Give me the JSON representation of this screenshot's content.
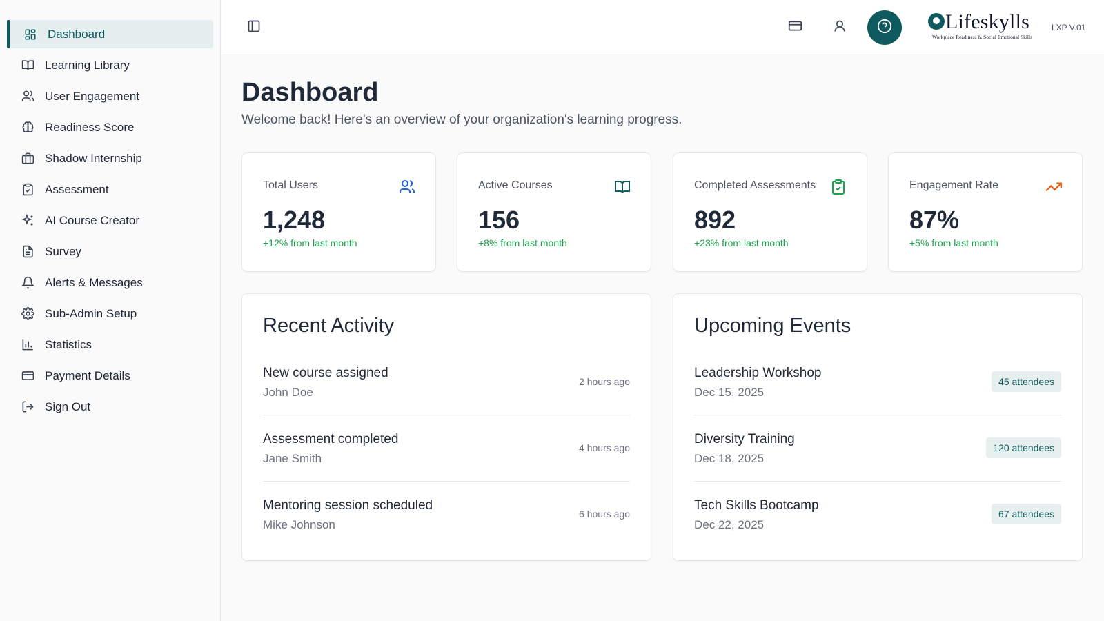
{
  "sidebar": {
    "items": [
      {
        "label": "Dashboard",
        "icon": "dashboard-grid-icon",
        "active": true
      },
      {
        "label": "Learning Library",
        "icon": "book-open-icon"
      },
      {
        "label": "User Engagement",
        "icon": "users-icon"
      },
      {
        "label": "Readiness Score",
        "icon": "brain-icon"
      },
      {
        "label": "Shadow Internship",
        "icon": "briefcase-icon"
      },
      {
        "label": "Assessment",
        "icon": "clipboard-check-icon"
      },
      {
        "label": "AI Course Creator",
        "icon": "sparkles-icon"
      },
      {
        "label": "Survey",
        "icon": "file-text-icon"
      },
      {
        "label": "Alerts & Messages",
        "icon": "bell-icon"
      },
      {
        "label": "Sub-Admin Setup",
        "icon": "gear-icon"
      },
      {
        "label": "Statistics",
        "icon": "bar-chart-icon"
      },
      {
        "label": "Payment Details",
        "icon": "credit-card-icon"
      },
      {
        "label": "Sign Out",
        "icon": "sign-out-icon"
      }
    ]
  },
  "header": {
    "logo_text": "Lifeskylls",
    "logo_tagline": "Workplace Readiness & Social Emotional Skills",
    "version": "LXP V.01",
    "icons": [
      "sidebar-toggle-icon",
      "credit-card-icon",
      "user-icon",
      "help-circle-icon"
    ]
  },
  "page": {
    "title": "Dashboard",
    "subtitle": "Welcome back! Here's an overview of your organization's learning progress."
  },
  "stats": [
    {
      "label": "Total Users",
      "value": "1,248",
      "change": "+12% from last month",
      "icon": "users-icon",
      "icon_color": "#2563eb"
    },
    {
      "label": "Active Courses",
      "value": "156",
      "change": "+8% from last month",
      "icon": "book-open-icon",
      "icon_color": "#0f5a5e"
    },
    {
      "label": "Completed Assessments",
      "value": "892",
      "change": "+23% from last month",
      "icon": "clipboard-check-icon",
      "icon_color": "#16a34a"
    },
    {
      "label": "Engagement Rate",
      "value": "87%",
      "change": "+5% from last month",
      "icon": "trending-up-icon",
      "icon_color": "#ea580c"
    }
  ],
  "recent_activity": {
    "title": "Recent Activity",
    "items": [
      {
        "title": "New course assigned",
        "person": "John Doe",
        "time": "2 hours ago"
      },
      {
        "title": "Assessment completed",
        "person": "Jane Smith",
        "time": "4 hours ago"
      },
      {
        "title": "Mentoring session scheduled",
        "person": "Mike Johnson",
        "time": "6 hours ago"
      }
    ]
  },
  "upcoming_events": {
    "title": "Upcoming Events",
    "items": [
      {
        "title": "Leadership Workshop",
        "date": "Dec 15, 2025",
        "attendees": "45 attendees"
      },
      {
        "title": "Diversity Training",
        "date": "Dec 18, 2025",
        "attendees": "120 attendees"
      },
      {
        "title": "Tech Skills Bootcamp",
        "date": "Dec 22, 2025",
        "attendees": "67 attendees"
      }
    ]
  },
  "colors": {
    "accent": "#0f5a5e",
    "positive": "#16a34a",
    "badge_bg": "#e8f0ef"
  }
}
